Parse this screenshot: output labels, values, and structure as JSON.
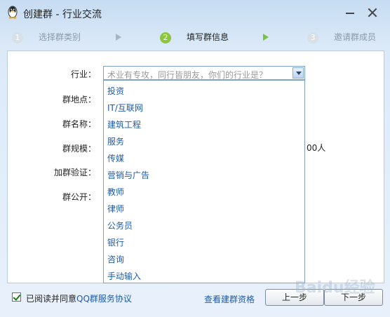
{
  "window": {
    "title": "创建群 - 行业交流",
    "icon": "qq-penguin-icon",
    "controls": [
      "minimize-icon",
      "close-icon"
    ]
  },
  "steps": [
    {
      "num": "1",
      "label": "选择群类别",
      "state": "done"
    },
    {
      "num": "2",
      "label": "填写群信息",
      "state": "active"
    },
    {
      "num": "3",
      "label": "邀请群成员",
      "state": "pending"
    }
  ],
  "form": {
    "industry_label": "行业：",
    "location_label": "群地点：",
    "name_label": "群名称：",
    "size_label": "群规模：",
    "verify_label": "加群验证：",
    "public_label": "群公开：",
    "industry_placeholder": "术业有专攻，同行皆朋友，你们的行业是？",
    "size_partial_text": "00人"
  },
  "industry_options": [
    "投资",
    "IT/互联网",
    "建筑工程",
    "服务",
    "传媒",
    "营销与广告",
    "教师",
    "律师",
    "公务员",
    "银行",
    "咨询",
    "手动输入"
  ],
  "footer": {
    "agree_checked": true,
    "agree_text": "已阅读并同意",
    "agree_link": "QQ群服务协议",
    "view_link": "查看建群资格",
    "prev_button": "上一步",
    "next_button": "下一步"
  },
  "colors": {
    "accent_green": "#8cc63f",
    "link_blue": "#1e5ba8",
    "window_bg": "#dceaf8"
  },
  "watermark": "Baidu经验"
}
